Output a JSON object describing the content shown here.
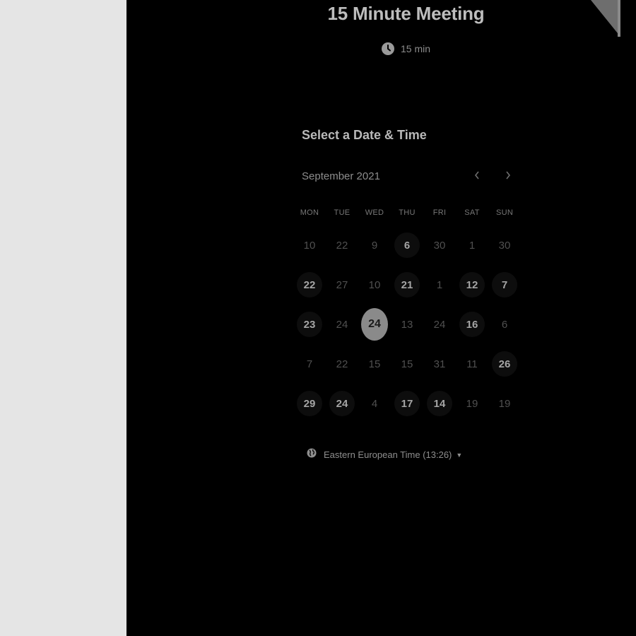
{
  "event": {
    "title": "15 Minute Meeting",
    "duration": "15 min",
    "duration_icon": "clock-icon"
  },
  "scheduler": {
    "heading": "Select a Date & Time",
    "month": "September 2021",
    "prev_icon": "chevron-left-icon",
    "next_icon": "chevron-right-icon",
    "weekdays": [
      "MON",
      "TUE",
      "WED",
      "THU",
      "FRI",
      "SAT",
      "SUN"
    ],
    "weeks": [
      [
        {
          "label": "10",
          "available": false
        },
        {
          "label": "22",
          "available": false
        },
        {
          "label": "9",
          "available": false
        },
        {
          "label": "6",
          "available": true
        },
        {
          "label": "30",
          "available": false
        },
        {
          "label": "1",
          "available": false
        },
        {
          "label": "30",
          "available": false
        }
      ],
      [
        {
          "label": "22",
          "available": true
        },
        {
          "label": "27",
          "available": false
        },
        {
          "label": "10",
          "available": false
        },
        {
          "label": "21",
          "available": true
        },
        {
          "label": "1",
          "available": false
        },
        {
          "label": "12",
          "available": true
        },
        {
          "label": "7",
          "available": true
        }
      ],
      [
        {
          "label": "23",
          "available": true
        },
        {
          "label": "24",
          "available": false
        },
        {
          "label": "24",
          "available": true,
          "selected": true
        },
        {
          "label": "13",
          "available": false
        },
        {
          "label": "24",
          "available": false
        },
        {
          "label": "16",
          "available": true
        },
        {
          "label": "6",
          "available": false
        }
      ],
      [
        {
          "label": "7",
          "available": false
        },
        {
          "label": "22",
          "available": false
        },
        {
          "label": "15",
          "available": false
        },
        {
          "label": "15",
          "available": false
        },
        {
          "label": "31",
          "available": false
        },
        {
          "label": "11",
          "available": false
        },
        {
          "label": "26",
          "available": true
        }
      ],
      [
        {
          "label": "29",
          "available": true
        },
        {
          "label": "24",
          "available": true
        },
        {
          "label": "4",
          "available": false
        },
        {
          "label": "17",
          "available": true
        },
        {
          "label": "14",
          "available": true
        },
        {
          "label": "19",
          "available": false
        },
        {
          "label": "19",
          "available": false
        }
      ]
    ],
    "timezone": "Eastern European Time (13:26)",
    "timezone_icon": "globe-icon"
  },
  "colors": {
    "background": "#000000",
    "sidebar": "#e5e5e5",
    "selected_day": "#8a8a8a"
  }
}
